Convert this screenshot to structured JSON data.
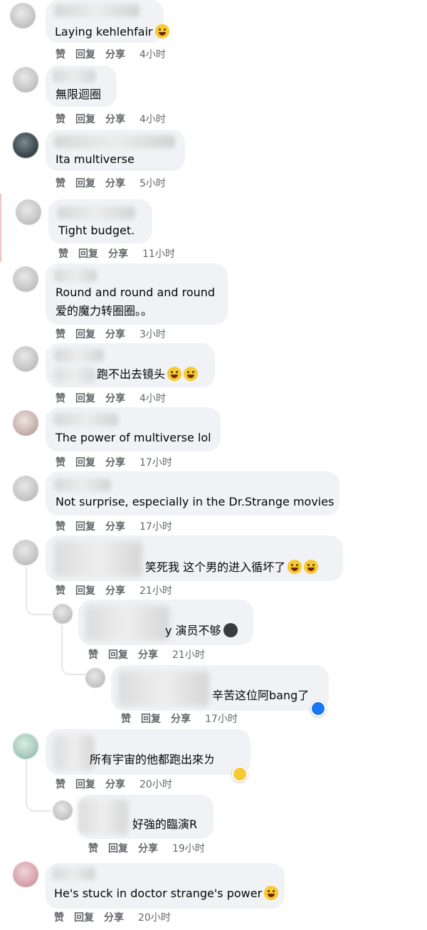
{
  "actions": {
    "like": "赞",
    "reply": "回复",
    "share": "分享"
  },
  "comments": [
    {
      "text": "Laying kehlehfair",
      "time": "4小时",
      "emoji": "laugh"
    },
    {
      "text": "無限迴圈",
      "time": "4小时"
    },
    {
      "text": "Ita multiverse",
      "time": "5小时"
    },
    {
      "text": "Tight budget.",
      "time": "11小时"
    },
    {
      "line1": "Round and round and round",
      "line2": "爱的魔力转圈圈。。",
      "time": "3小时"
    },
    {
      "text": "跑不出去镜头",
      "time": "4小时",
      "emoji": "rofl"
    },
    {
      "text": "The power of multiverse lol",
      "time": "17小时"
    },
    {
      "text": "Not surprise, especially in the Dr.Strange movies",
      "time": "17小时"
    },
    {
      "text": "笑死我 这个男的进入循坏了",
      "time": "21小时",
      "emoji": "rofl"
    },
    {
      "text": "y 演员不够",
      "time": "21小时",
      "emoji": "dark"
    },
    {
      "text": "辛苦这位阿bang了",
      "time": "17小时",
      "reaction": "like"
    },
    {
      "text": "所有宇宙的他都跑出來ㄌ",
      "time": "20小时",
      "reaction": "wow"
    },
    {
      "text": "好強的臨演R",
      "time": "19小时"
    },
    {
      "text": "He's stuck in doctor strange's power",
      "time": "20小时",
      "emoji": "rofl"
    }
  ]
}
